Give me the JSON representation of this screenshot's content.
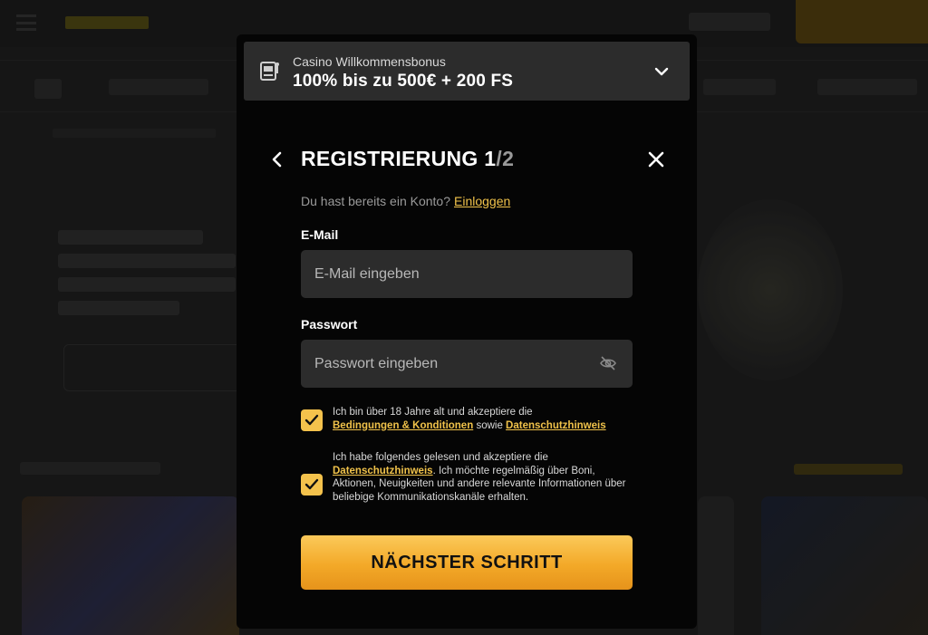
{
  "bonus": {
    "subtitle": "Casino Willkommensbonus",
    "headline": "100% bis zu 500€ + 200 FS",
    "icon": "slot-machine-icon",
    "expand_icon": "chevron-down-icon"
  },
  "modal": {
    "title_main": "REGISTRIERUNG 1",
    "title_step": "/2",
    "back_icon": "chevron-left-icon",
    "close_icon": "close-icon"
  },
  "account_prompt": {
    "text": "Du hast bereits ein Konto?",
    "link": "Einloggen"
  },
  "email": {
    "label": "E-Mail",
    "placeholder": "E-Mail eingeben",
    "value": ""
  },
  "password": {
    "label": "Passwort",
    "placeholder": "Passwort eingeben",
    "value": "",
    "toggle_icon": "eye-off-icon"
  },
  "consent_terms": {
    "checked": true,
    "text_before": "Ich bin über 18 Jahre alt und akzeptiere die",
    "link_terms": "Bedingungen & Konditionen",
    "text_between": "sowie",
    "link_privacy": "Datenschutzhinweis"
  },
  "consent_marketing": {
    "checked": true,
    "text_before": "Ich habe folgendes gelesen und akzeptiere die",
    "link_privacy": "Datenschutzhinweis",
    "text_after": ". Ich möchte regelmäßig über Boni, Aktionen, Neuigkeiten und andere relevante Informationen über beliebige Kommunikationskanäle erhalten."
  },
  "next_button": {
    "label": "NÄCHSTER SCHRITT"
  },
  "colors": {
    "accent": "#f4c24c",
    "modal_bg": "#050505",
    "field_bg": "#2c2c2c"
  }
}
